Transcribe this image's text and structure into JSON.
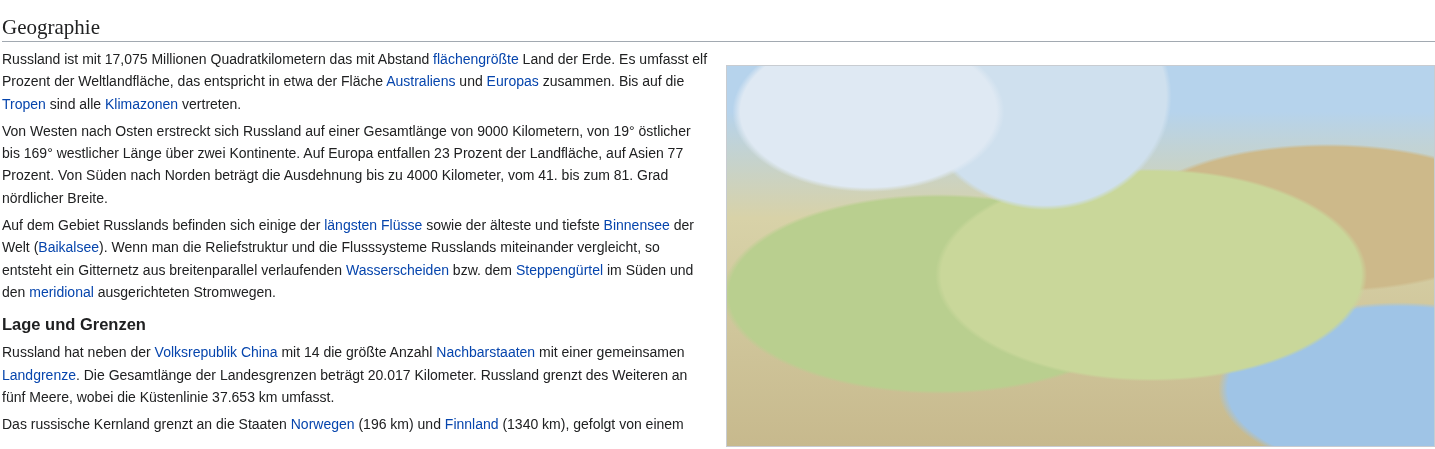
{
  "section_title": "Geographie",
  "intro_paragraphs": [
    [
      {
        "text": "Russland ist mit 17,075 Millionen Quadratkilometern das mit Abstand "
      },
      {
        "text": "flächengrößte",
        "link": true
      },
      {
        "text": " Land der Erde. Es umfasst elf Prozent der Weltlandfläche, das entspricht in etwa der Fläche "
      },
      {
        "text": "Australiens",
        "link": true
      },
      {
        "text": " und "
      },
      {
        "text": "Europas",
        "link": true
      },
      {
        "text": " zusammen. Bis auf die "
      },
      {
        "text": "Tropen",
        "link": true
      },
      {
        "text": " sind alle "
      },
      {
        "text": "Klimazonen",
        "link": true
      },
      {
        "text": " vertreten."
      }
    ],
    [
      {
        "text": "Von Westen nach Osten erstreckt sich Russland auf einer Gesamtlänge von 9000 Kilometern, von 19° östlicher bis 169° westlicher Länge über zwei Kontinente. Auf Europa entfallen 23 Prozent der Landfläche, auf Asien 77 Prozent. Von Süden nach Norden beträgt die Ausdehnung bis zu 4000 Kilometer, vom 41. bis zum 81. Grad nördlicher Breite."
      }
    ],
    [
      {
        "text": "Auf dem Gebiet Russlands befinden sich einige der "
      },
      {
        "text": "längsten Flüsse",
        "link": true
      },
      {
        "text": " sowie der älteste und tiefste "
      },
      {
        "text": "Binnensee",
        "link": true
      },
      {
        "text": " der Welt ("
      },
      {
        "text": "Baikalsee",
        "link": true
      },
      {
        "text": "). Wenn man die Reliefstruktur und die Flusssysteme Russlands miteinander vergleicht, so entsteht ein Gitternetz aus breitenparallel verlaufenden "
      },
      {
        "text": "Wasserscheiden",
        "link": true
      },
      {
        "text": " bzw. dem "
      },
      {
        "text": "Steppengürtel",
        "link": true
      },
      {
        "text": " im Süden und den "
      },
      {
        "text": "meridional",
        "link": true
      },
      {
        "text": " ausgerichteten Stromwegen."
      }
    ]
  ],
  "subsection_title": "Lage und Grenzen",
  "subsection_paragraphs": [
    [
      {
        "text": "Russland hat neben der "
      },
      {
        "text": "Volksrepublik China",
        "link": true
      },
      {
        "text": " mit 14 die größte Anzahl "
      },
      {
        "text": "Nachbarstaaten",
        "link": true
      },
      {
        "text": " mit einer gemeinsamen "
      },
      {
        "text": "Landgrenze",
        "link": true
      },
      {
        "text": ". Die Gesamtlänge der Landesgrenzen beträgt 20.017 Kilometer. Russland grenzt des Weiteren an fünf Meere, wobei die Küstenlinie 37.653 km umfasst."
      }
    ],
    [
      {
        "text": "Das russische Kernland grenzt an die Staaten "
      },
      {
        "text": "Norwegen",
        "link": true
      },
      {
        "text": " (196 km) und "
      },
      {
        "text": "Finnland",
        "link": true
      },
      {
        "text": " (1340 km), gefolgt von einem"
      }
    ]
  ]
}
